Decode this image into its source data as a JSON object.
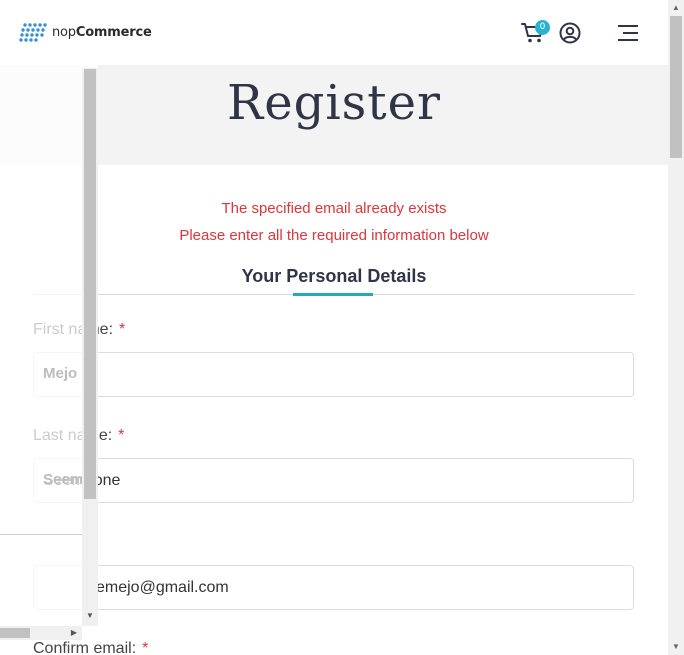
{
  "header": {
    "logo_light": "nop",
    "logo_bold": "Commerce",
    "cart_count": "0"
  },
  "page": {
    "title": "Register",
    "errors": [
      "The specified email already exists",
      "Please enter all the required information below"
    ],
    "section_title": "Your Personal Details"
  },
  "form": {
    "first_name": {
      "label": "First name:",
      "required": "*",
      "value": "Mejo"
    },
    "last_name": {
      "label": "Last name:",
      "required": "*",
      "value": "Seemoone"
    },
    "email": {
      "value": "seemoonemejo@gmail.com",
      "visible_value": "emejo@gmail.com"
    },
    "confirm_email": {
      "label": "Confirm email:",
      "required": "*"
    }
  },
  "overlay": {
    "first_name_ghost": "Mejo",
    "last_name_ghost": "Seem"
  },
  "colors": {
    "accent": "#2aa6c0",
    "error": "#d9363e",
    "title": "#2f3546",
    "badge": "#2ab3d1"
  },
  "icons": [
    "logo-dots-icon",
    "cart-icon",
    "user-icon",
    "menu-icon",
    "chevron-down-icon",
    "chevron-right-icon",
    "chevron-up-icon"
  ]
}
